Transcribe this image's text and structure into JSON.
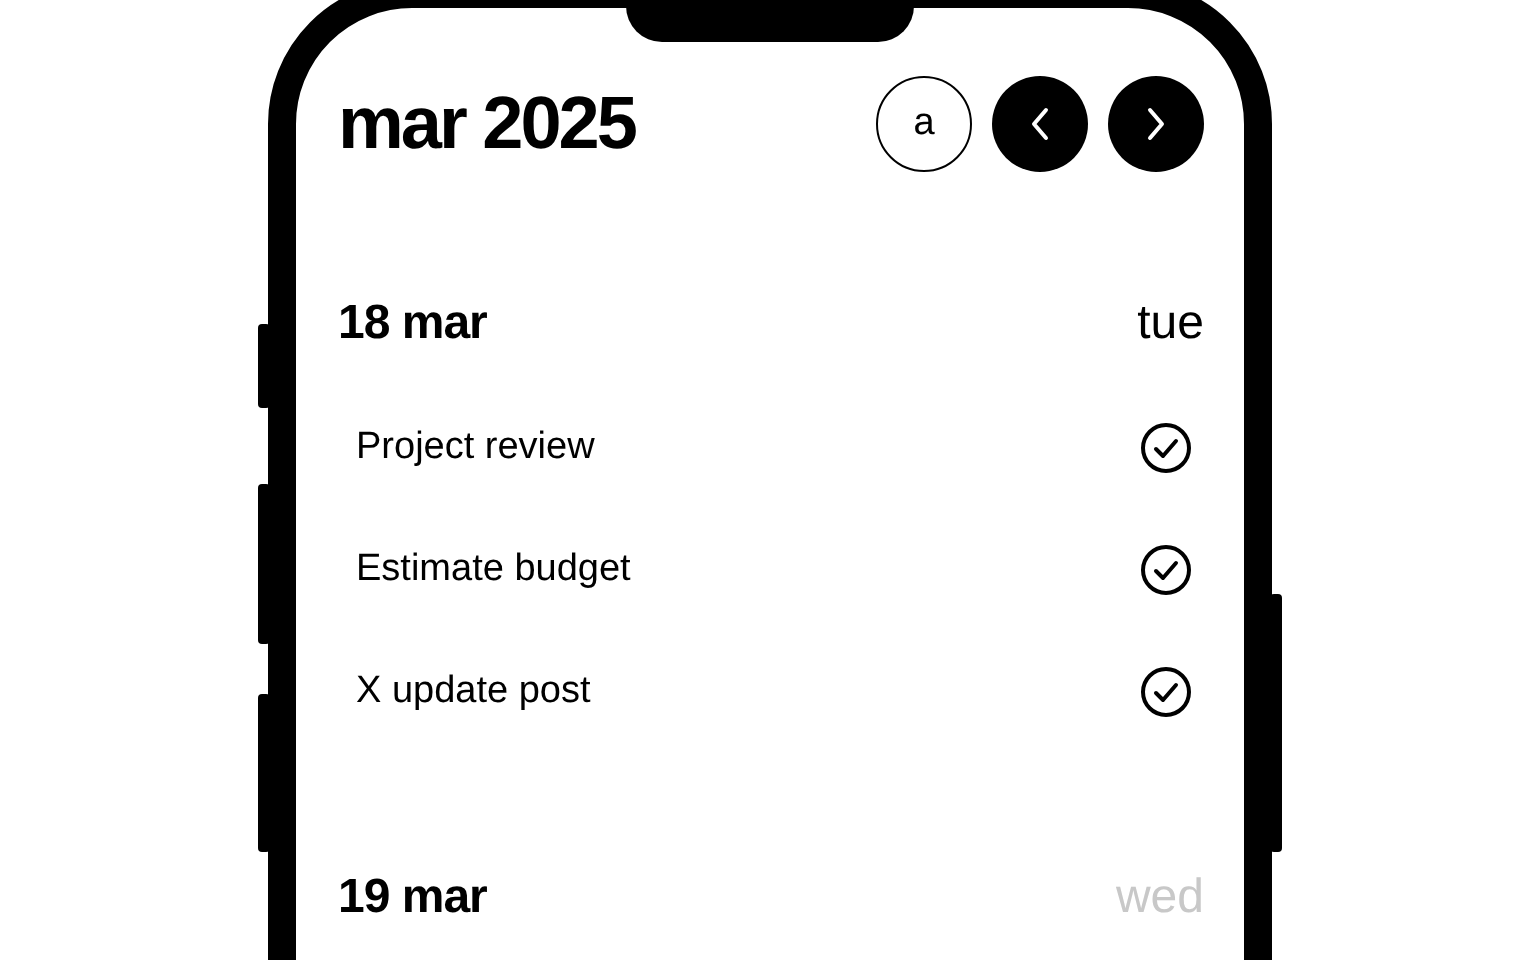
{
  "header": {
    "title": "mar 2025",
    "view_button": "a"
  },
  "days": [
    {
      "date": "18 mar",
      "weekday": "tue",
      "weekday_muted": false,
      "tasks": [
        {
          "label": "Project review",
          "done": true
        },
        {
          "label": "Estimate budget",
          "done": true
        },
        {
          "label": "X update post",
          "done": true
        }
      ]
    },
    {
      "date": "19 mar",
      "weekday": "wed",
      "weekday_muted": true
    }
  ]
}
